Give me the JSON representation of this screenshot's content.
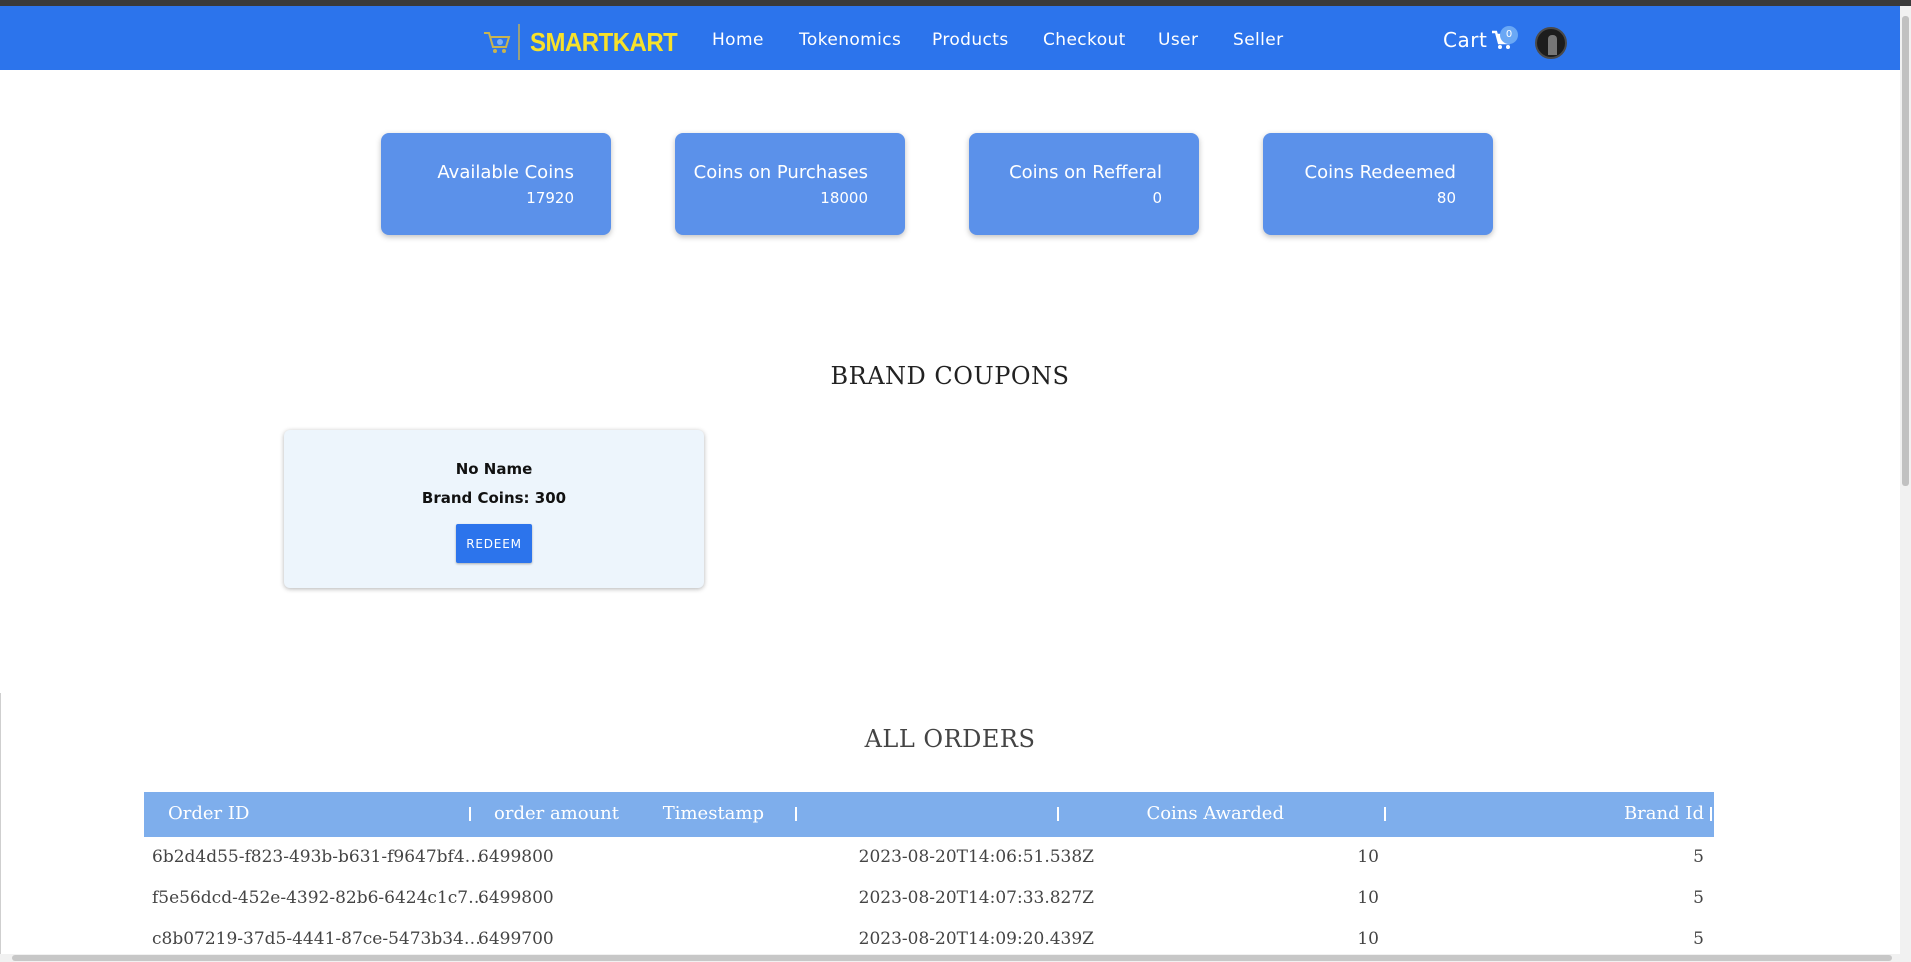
{
  "brand": {
    "name": "SMARTKART"
  },
  "nav": {
    "links": [
      "Home",
      "Tokenomics",
      "Products",
      "Checkout",
      "User",
      "Seller"
    ],
    "cart_label": "Cart",
    "cart_count": "0"
  },
  "stats": [
    {
      "title": "Available Coins",
      "value": "17920"
    },
    {
      "title": "Coins on Purchases",
      "value": "18000"
    },
    {
      "title": "Coins on Refferal",
      "value": "0"
    },
    {
      "title": "Coins Redeemed",
      "value": "80"
    }
  ],
  "coupons": {
    "heading": "BRAND COUPONS",
    "items": [
      {
        "name": "No Name",
        "coins": "Brand Coins: 300",
        "button": "REDEEM"
      }
    ]
  },
  "orders": {
    "heading": "ALL ORDERS",
    "columns": [
      "Order ID",
      "order amount",
      "Timestamp",
      "Coins Awarded",
      "Brand Id"
    ],
    "rows": [
      [
        "6b2d4d55-f823-493b-b631-f9647bf4…",
        "6499800",
        "2023-08-20T14:06:51.538Z",
        "10",
        "5"
      ],
      [
        "f5e56dcd-452e-4392-82b6-6424c1c7…",
        "6499800",
        "2023-08-20T14:07:33.827Z",
        "10",
        "5"
      ],
      [
        "c8b07219-37d5-4441-87ce-5473b34…",
        "6499700",
        "2023-08-20T14:09:20.439Z",
        "10",
        "5"
      ]
    ]
  },
  "colors": {
    "primary": "#2c74ec",
    "card": "#5b91ea",
    "table_header": "#7eaeec",
    "logo_text": "#f7e12a"
  },
  "icons": {
    "cart": "shopping-cart-icon",
    "logo": "logo-cart-icon",
    "avatar": "user-avatar"
  }
}
